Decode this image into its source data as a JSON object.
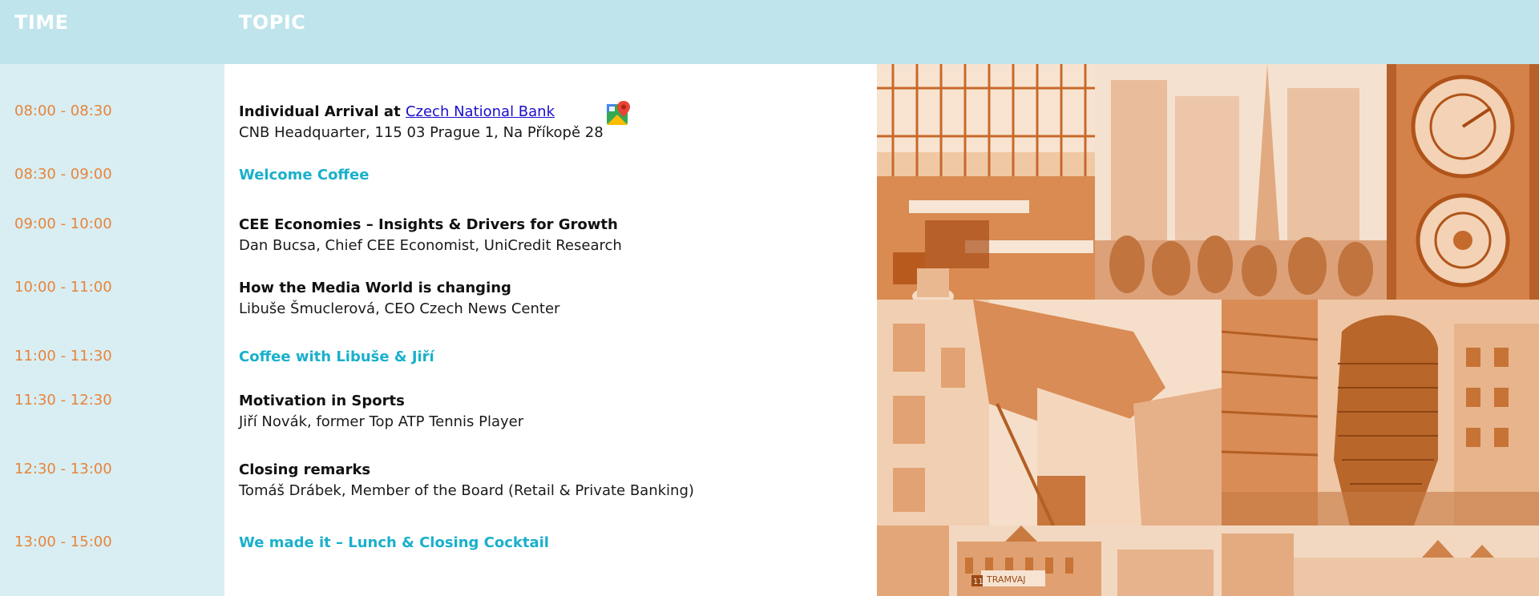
{
  "header": {
    "time_label": "TIME",
    "topic_label": "TOPIC"
  },
  "agenda": [
    {
      "time": "08:00 - 08:30",
      "title_prefix": "Individual Arrival at ",
      "link": "Czech National Bank",
      "sub": "CNB Headquarter, 115 03 Prague 1, Na Příkopě 28"
    },
    {
      "time": "08:30 - 09:00",
      "title": "Welcome Coffee"
    },
    {
      "time": "09:00  - 10:00",
      "title": "CEE Economies – Insights & Drivers for Growth",
      "sub": "Dan Bucsa, Chief CEE Economist, UniCredit Research"
    },
    {
      "time": "10:00 - 11:00",
      "title": "How the Media World is changing",
      "sub": "Libuše Šmuclerová, CEO Czech News Center"
    },
    {
      "time": "11:00 - 11:30",
      "title": "Coffee with Libuše & Jiří"
    },
    {
      "time": "11:30 - 12:30",
      "title": "Motivation in Sports",
      "sub": "Jiří Novák, former Top ATP Tennis Player"
    },
    {
      "time": "12:30 - 13:00",
      "title": "Closing remarks",
      "sub": "Tomáš Drábek, Member of the Board (Retail & Private Banking)"
    },
    {
      "time": "13:00 - 15:00",
      "title": "We made it – Lunch & Closing Cocktail"
    }
  ],
  "colors": {
    "header_bg": "#bfe4ec",
    "time_col_bg": "#d8eef3",
    "time_text": "#e8843a",
    "accent_text": "#1ab0cc",
    "photo_tint": "#e0803a"
  },
  "icons": {
    "map": "google-maps-icon"
  },
  "tram_sign": "TRAMVAJ",
  "tram_number": "11"
}
